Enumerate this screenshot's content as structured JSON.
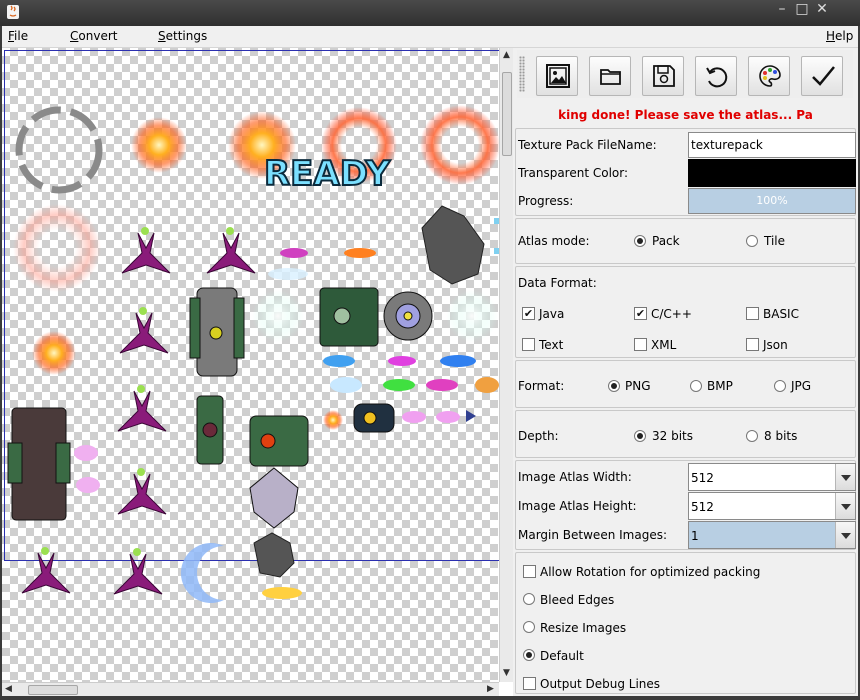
{
  "menu": {
    "file": "File",
    "convert": "Convert",
    "settings": "Settings",
    "help": "Help"
  },
  "atlas": {
    "ready_text": "READY"
  },
  "toolbar": {
    "buttons": [
      {
        "name": "image-icon"
      },
      {
        "name": "folder-icon"
      },
      {
        "name": "save-icon"
      },
      {
        "name": "refresh-icon"
      },
      {
        "name": "palette-icon"
      },
      {
        "name": "checkmark-icon"
      }
    ]
  },
  "status_text": "king done! Please save the atlas...  Pa",
  "settings": {
    "texture_pack_label": "Texture Pack FileName:",
    "texture_pack_value": "texturepack",
    "transparent_color_label": "Transparent Color:",
    "transparent_color_value": "#000000",
    "progress_label": "Progress:",
    "progress_value": "100%",
    "atlas_mode_label": "Atlas mode:",
    "atlas_mode_pack": "Pack",
    "atlas_mode_tile": "Tile",
    "data_format_label": "Data Format:",
    "df_java": "Java",
    "df_cpp": "C/C++",
    "df_basic": "BASIC",
    "df_text": "Text",
    "df_xml": "XML",
    "df_json": "Json",
    "format_label": "Format:",
    "fmt_png": "PNG",
    "fmt_bmp": "BMP",
    "fmt_jpg": "JPG",
    "depth_label": "Depth:",
    "depth_32": "32 bits",
    "depth_8": "8 bits",
    "atlas_width_label": "Image Atlas Width:",
    "atlas_width_value": "512",
    "atlas_height_label": "Image Atlas Height:",
    "atlas_height_value": "512",
    "margin_label": "Margin Between Images:",
    "margin_value": "1",
    "allow_rotation": "Allow Rotation for optimized packing",
    "bleed_edges": "Bleed Edges",
    "resize_images": "Resize Images",
    "default": "Default",
    "output_debug": "Output Debug Lines"
  }
}
